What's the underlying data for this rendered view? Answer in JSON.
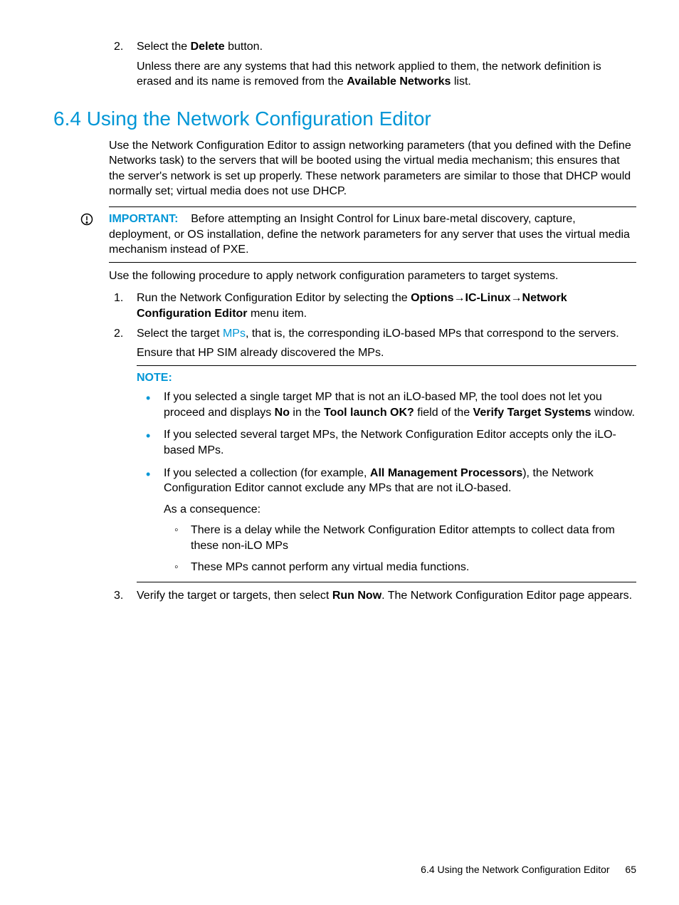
{
  "preList": {
    "item2": {
      "num": "2.",
      "select": "Select the ",
      "delete": "Delete",
      "button": " button.",
      "unless_pre": "Unless there are any systems that had this network applied to them, the network definition is erased and its name is removed from the ",
      "avail": "Available Networks",
      "list": " list."
    }
  },
  "heading": "6.4 Using the Network Configuration Editor",
  "intro": "Use the Network Configuration Editor to assign networking parameters (that you defined with the Define Networks task) to the servers that will be booted using the virtual media mechanism; this ensures that the server's network is set up properly. These network parameters are similar to those that DHCP would normally set; virtual media does not use DHCP.",
  "important": {
    "label": "IMPORTANT:",
    "text": "Before attempting an Insight Control for Linux bare-metal discovery, capture, deployment, or OS installation, define the network parameters for any server that uses the virtual media mechanism instead of PXE."
  },
  "proc_intro": "Use the following procedure to apply network configuration parameters to target systems.",
  "steps": {
    "s1": {
      "num": "1.",
      "pre": "Run the Network Configuration Editor by selecting the ",
      "opt": "Options",
      "arrow1": "→",
      "ic": "IC-Linux",
      "arrow2": "→",
      "nce": "Network Configuration Editor",
      "post": " menu item."
    },
    "s2": {
      "num": "2.",
      "pre": "Select the target ",
      "mps": "MPs",
      "post": ", that is, the corresponding iLO-based MPs that correspond to the servers.",
      "ensure": "Ensure that HP SIM already discovered the MPs."
    },
    "s3": {
      "num": "3.",
      "pre": "Verify the target or targets, then select ",
      "run": "Run Now",
      "post": ". The Network Configuration Editor page appears."
    }
  },
  "note": {
    "label": "NOTE:",
    "b1": {
      "pre": "If you selected a single target MP that is not an iLO-based MP, the tool does not let you proceed and displays ",
      "no": "No",
      "mid": " in the ",
      "tlok": "Tool launch OK?",
      "mid2": " field of the ",
      "vts": "Verify Target Systems",
      "post": " window."
    },
    "b2": "If you selected several target MPs, the Network Configuration Editor accepts only the iLO-based MPs.",
    "b3": {
      "pre": "If you selected a collection (for example, ",
      "amp": "All Management Processors",
      "post": "), the Network Configuration Editor cannot exclude any MPs that are not iLO-based.",
      "cons": "As a consequence:",
      "s1": "There is a delay while the Network Configuration Editor attempts to collect data from these non-iLO MPs",
      "s2": "These MPs cannot perform any virtual media functions."
    }
  },
  "footer": {
    "text": "6.4 Using the Network Configuration Editor",
    "page": "65"
  }
}
